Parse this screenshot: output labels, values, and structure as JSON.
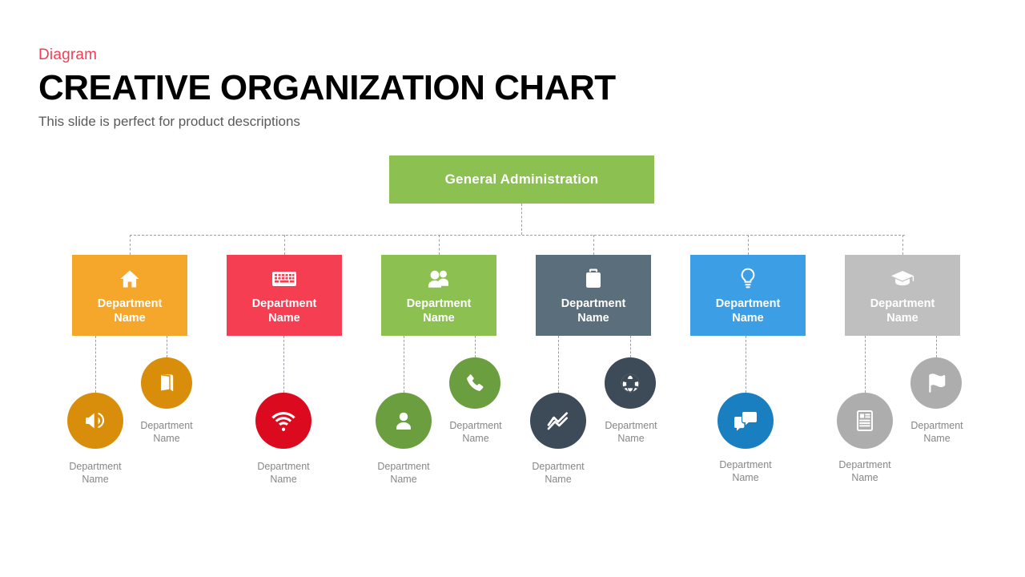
{
  "header": {
    "kicker": "Diagram",
    "title": "CREATIVE ORGANIZATION CHART",
    "subtitle": "This slide is perfect for product descriptions",
    "kicker_color": "#ef4056"
  },
  "root": {
    "label": "General Administration",
    "color": "#8CC152"
  },
  "columns": [
    {
      "box": {
        "label": "Department\nName",
        "color": "#F5A72B",
        "icon": "home-icon"
      },
      "circles": [
        {
          "label": "Department\nName",
          "color": "#D98E0B",
          "icon": "megaphone-icon",
          "position": "lower-left"
        },
        {
          "label": "Department\nName",
          "color": "#D98E0B",
          "icon": "book-icon",
          "position": "upper-right"
        }
      ]
    },
    {
      "box": {
        "label": "Department\nName",
        "color": "#F53E52",
        "icon": "keyboard-icon"
      },
      "circles": [
        {
          "label": "Department\nName",
          "color": "#DB0A1E",
          "icon": "wifi-icon",
          "position": "center"
        }
      ]
    },
    {
      "box": {
        "label": "Department\nName",
        "color": "#8CC152",
        "icon": "users-icon"
      },
      "circles": [
        {
          "label": "Department\nName",
          "color": "#6A9E3F",
          "icon": "user-icon",
          "position": "lower-left"
        },
        {
          "label": "Department\nName",
          "color": "#6A9E3F",
          "icon": "phone-icon",
          "position": "upper-right"
        }
      ]
    },
    {
      "box": {
        "label": "Department\nName",
        "color": "#5A6E7C",
        "icon": "briefcase-icon"
      },
      "circles": [
        {
          "label": "Department\nName",
          "color": "#3D4A57",
          "icon": "line-chart-icon",
          "position": "lower-left"
        },
        {
          "label": "Department\nName",
          "color": "#3D4A57",
          "icon": "globe-icon",
          "position": "upper-right"
        }
      ]
    },
    {
      "box": {
        "label": "Department\nName",
        "color": "#3C9FE6",
        "icon": "lightbulb-icon"
      },
      "circles": [
        {
          "label": "Department\nName",
          "color": "#1A7FC1",
          "icon": "chat-icon",
          "position": "center"
        }
      ]
    },
    {
      "box": {
        "label": "Department\nName",
        "color": "#BFBFBF",
        "icon": "graduation-cap-icon"
      },
      "circles": [
        {
          "label": "Department\nName",
          "color": "#ADADAD",
          "icon": "newspaper-icon",
          "position": "lower-left"
        },
        {
          "label": "Department\nName",
          "color": "#ADADAD",
          "icon": "flag-icon",
          "position": "upper-right"
        }
      ]
    }
  ],
  "connector": {
    "color": "#9aa0a6",
    "style": "dashed"
  }
}
